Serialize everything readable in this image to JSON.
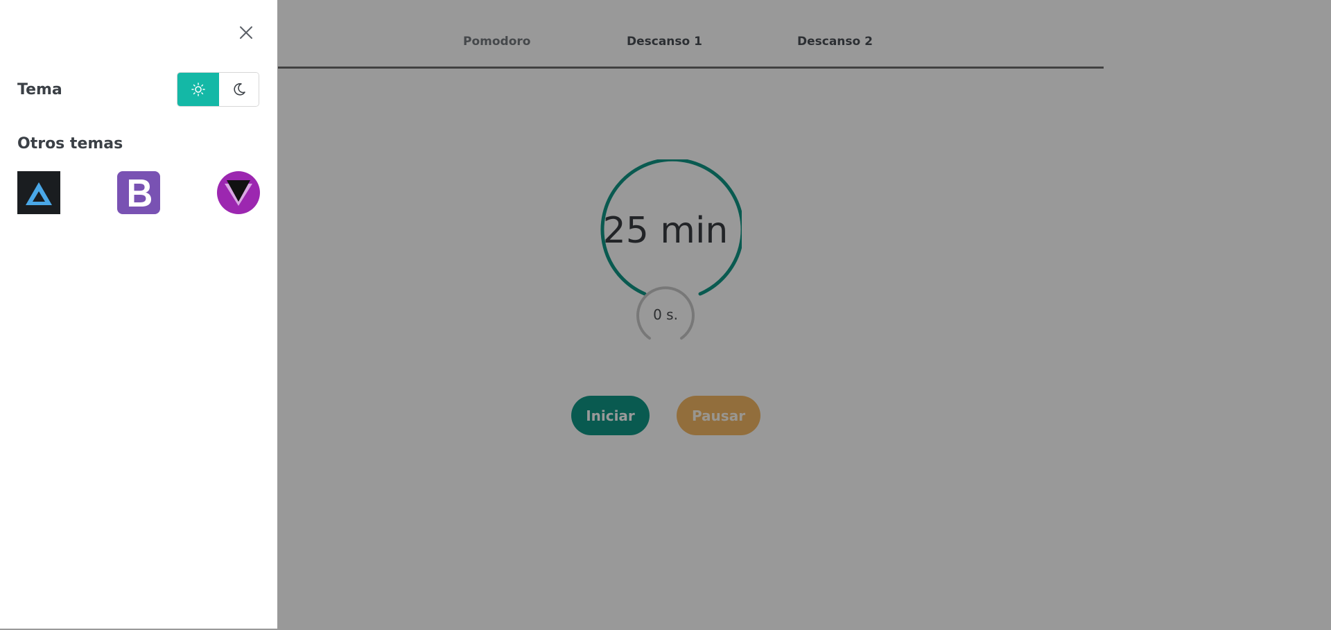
{
  "tabs": [
    {
      "label": "Pomodoro",
      "active": true
    },
    {
      "label": "Descanso 1",
      "active": false
    },
    {
      "label": "Descanso 2",
      "active": false
    }
  ],
  "timer": {
    "minutes_label": "25 min",
    "seconds_label": "0 s."
  },
  "buttons": {
    "start_label": "Iniciar",
    "pause_label": "Pausar"
  },
  "settings_panel": {
    "theme_label": "Tema",
    "theme_mode": "light",
    "other_themes_label": "Otros temas",
    "other_themes": [
      {
        "icon": "arwes-theme-icon"
      },
      {
        "icon": "bootstrap-theme-icon"
      },
      {
        "icon": "vuetify-theme-icon"
      }
    ]
  },
  "colors": {
    "accent_teal": "#14b8a6",
    "timer_ring": "#0f9786",
    "pause_button": "#f4b864",
    "bootstrap_purple": "#7952b3"
  }
}
